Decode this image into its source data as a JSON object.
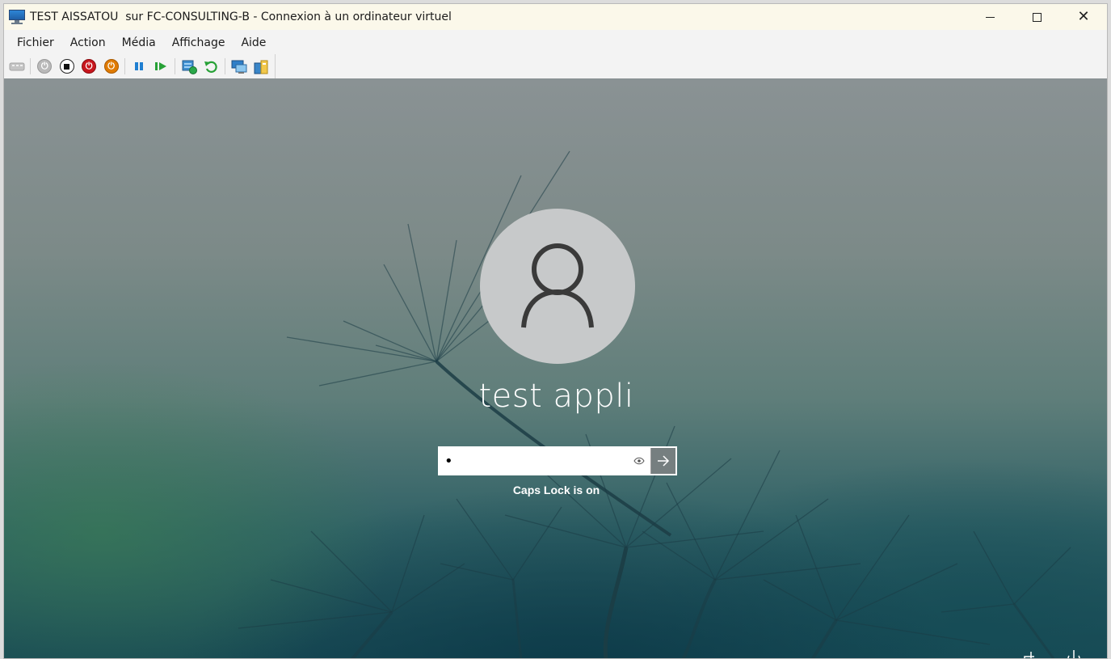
{
  "window": {
    "title": "TEST AISSATOU  sur FC-CONSULTING-B - Connexion à un ordinateur virtuel",
    "app_icon": "virtual-machine-connection-icon",
    "controls": {
      "minimize_icon": "minimize-icon",
      "maximize_icon": "maximize-icon",
      "close_icon": "close-icon",
      "close_glyph": "✕"
    }
  },
  "menu": {
    "items": [
      "Fichier",
      "Action",
      "Média",
      "Affichage",
      "Aide"
    ]
  },
  "toolbar": {
    "buttons": [
      {
        "name": "ctrl-alt-del-icon"
      },
      {
        "name": "start-icon"
      },
      {
        "name": "turn-off-icon"
      },
      {
        "name": "shutdown-icon"
      },
      {
        "name": "save-icon"
      },
      {
        "name": "pause-icon"
      },
      {
        "name": "resume-icon"
      },
      {
        "name": "checkpoint-icon"
      },
      {
        "name": "revert-icon"
      },
      {
        "name": "enhanced-session-icon"
      },
      {
        "name": "share-icon"
      }
    ]
  },
  "login": {
    "avatar_icon": "user-icon",
    "username": "test appli",
    "password_value": "•",
    "reveal_icon": "eye-icon",
    "submit_icon": "arrow-right-icon",
    "caps_lock_message": "Caps Lock is on"
  },
  "corner": {
    "icons": [
      "accessibility-icon",
      "power-icon"
    ]
  },
  "colors": {
    "titlebar_bg": "#fbf8ea",
    "avatar_bg": "#c7c9ca",
    "submit_bg": "#767f80",
    "stop_red": "#c8161d",
    "shutdown_orange": "#e07b00",
    "pause_blue": "#1f7fd1",
    "resume_green": "#27a136"
  }
}
